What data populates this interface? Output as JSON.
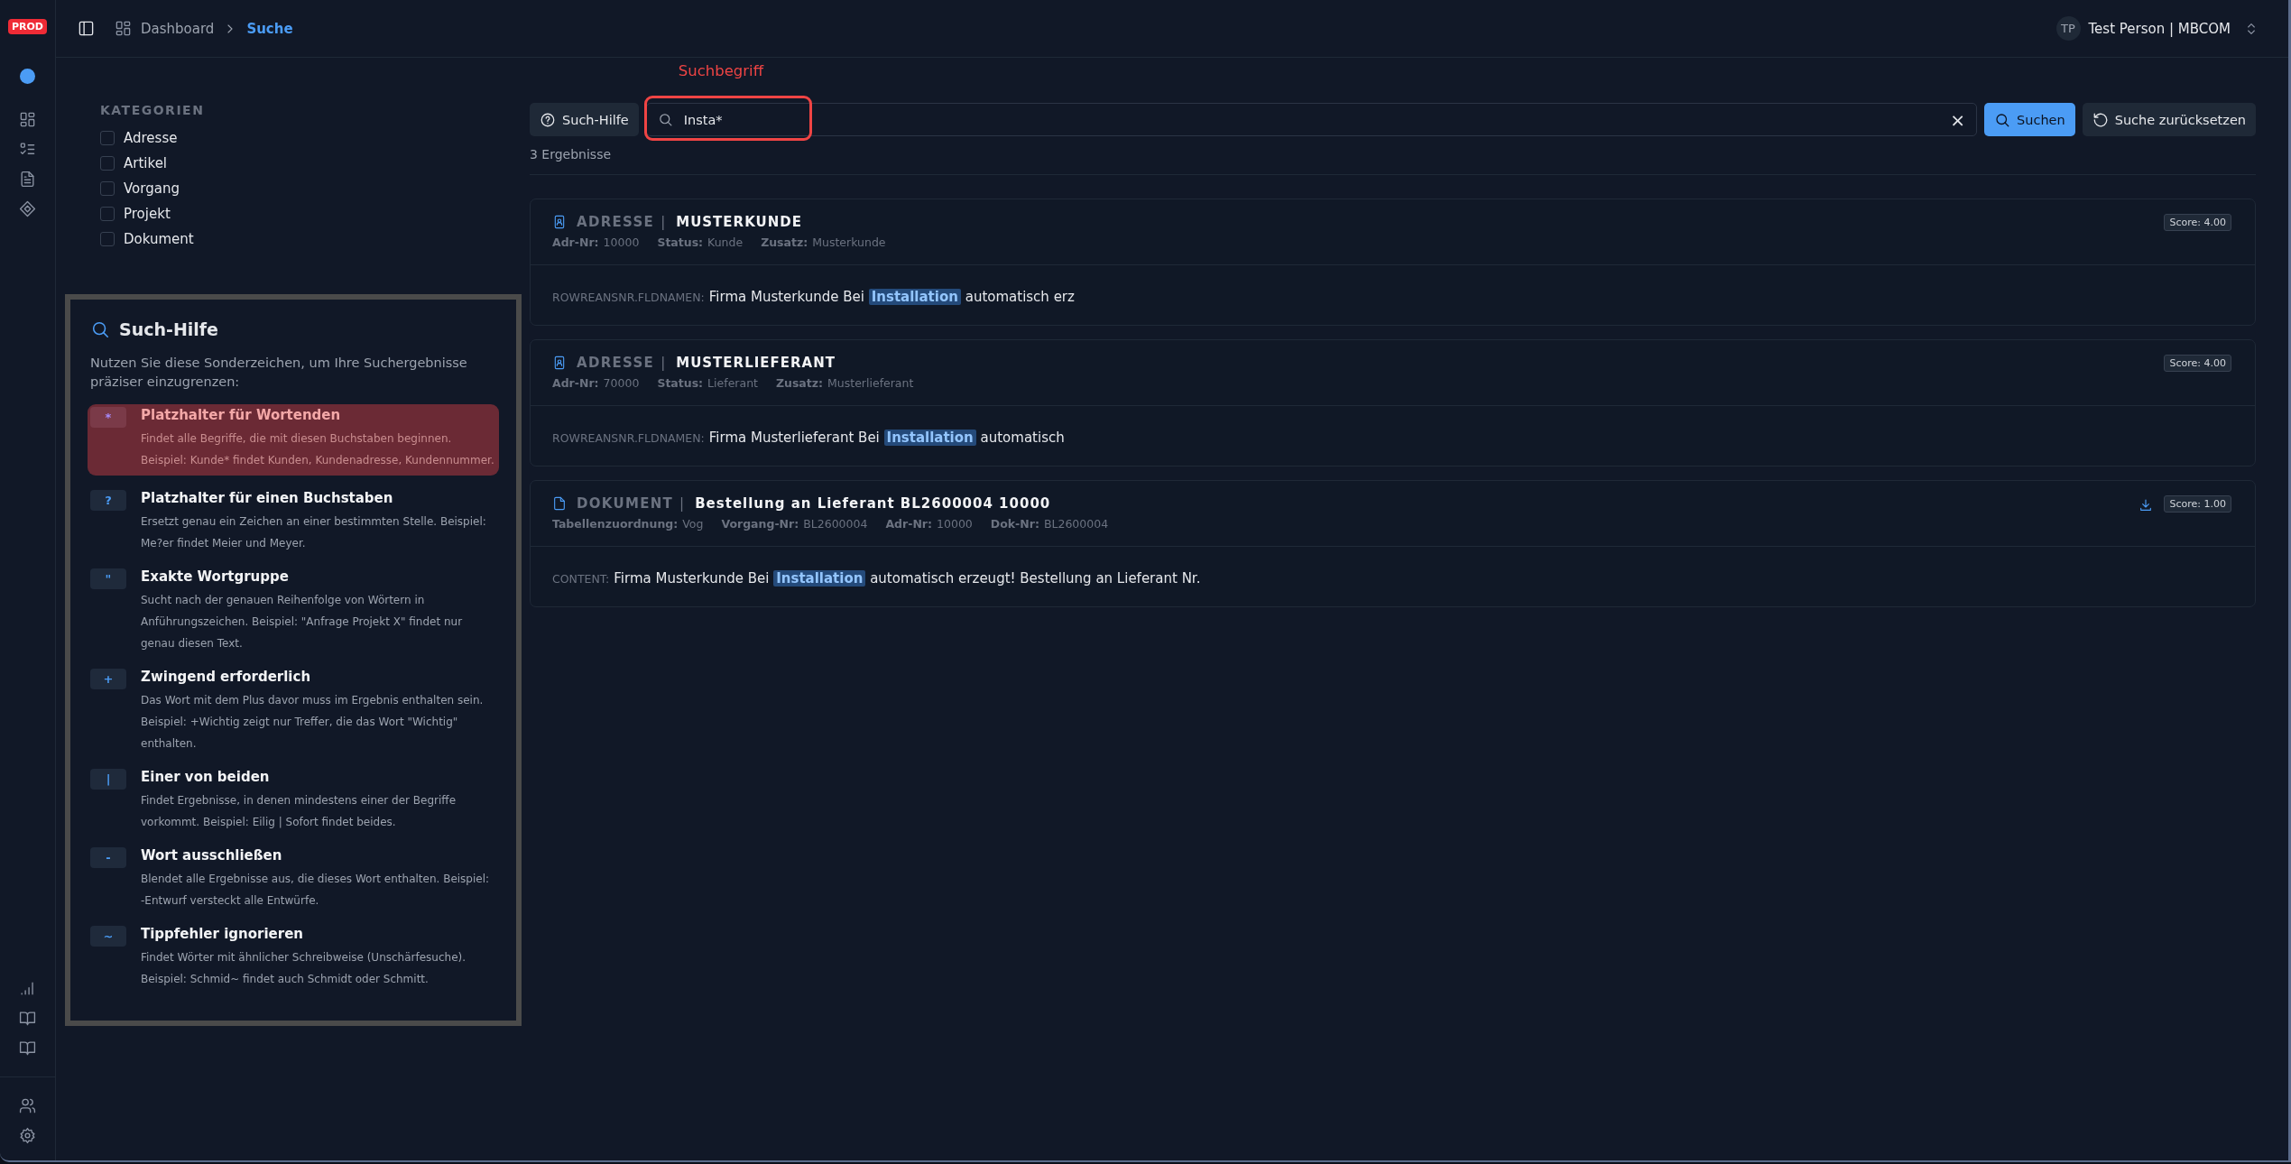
{
  "env_badge": "PROD",
  "breadcrumb": {
    "parent": "Dashboard",
    "current": "Suche"
  },
  "user": {
    "initials": "TP",
    "name": "Test Person | MBCOM"
  },
  "categories": {
    "title": "KATEGORIEN",
    "items": [
      {
        "label": "Adresse",
        "checked": false
      },
      {
        "label": "Artikel",
        "checked": false
      },
      {
        "label": "Vorgang",
        "checked": false
      },
      {
        "label": "Projekt",
        "checked": false
      },
      {
        "label": "Dokument",
        "checked": false
      }
    ]
  },
  "help": {
    "title": "Such-Hilfe",
    "intro": "Nutzen Sie diese Sonderzeichen, um Ihre Suchergebnisse präziser einzugrenzen:",
    "items": [
      {
        "symbol": "*",
        "title": "Platzhalter für Wortenden",
        "text": "Findet alle Begriffe, die mit diesen Buchstaben beginnen. Beispiel: Kunde* findet Kunden, Kundenadresse, Kundennummer.",
        "highlighted": true
      },
      {
        "symbol": "?",
        "title": "Platzhalter für einen Buchstaben",
        "text": "Ersetzt genau ein Zeichen an einer bestimmten Stelle. Beispiel: Me?er findet Meier und Meyer.",
        "highlighted": false
      },
      {
        "symbol": "\"",
        "title": "Exakte Wortgruppe",
        "text": "Sucht nach der genauen Reihenfolge von Wörtern in Anführungszeichen. Beispiel: \"Anfrage Projekt X\" findet nur genau diesen Text.",
        "highlighted": false
      },
      {
        "symbol": "+",
        "title": "Zwingend erforderlich",
        "text": "Das Wort mit dem Plus davor muss im Ergebnis enthalten sein. Beispiel: +Wichtig zeigt nur Treffer, die das Wort \"Wichtig\" enthalten.",
        "highlighted": false
      },
      {
        "symbol": "|",
        "title": "Einer von beiden",
        "text": "Findet Ergebnisse, in denen mindestens einer der Begriffe vorkommt. Beispiel: Eilig | Sofort findet beides.",
        "highlighted": false
      },
      {
        "symbol": "-",
        "title": "Wort ausschließen",
        "text": "Blendet alle Ergebnisse aus, die dieses Wort enthalten. Beispiel: -Entwurf versteckt alle Entwürfe.",
        "highlighted": false
      },
      {
        "symbol": "~",
        "title": "Tippfehler ignorieren",
        "text": "Findet Wörter mit ähnlicher Schreibweise (Unschärfesuche). Beispiel: Schmid~ findet auch Schmidt oder Schmitt.",
        "highlighted": false
      }
    ]
  },
  "search": {
    "help_button": "Such-Hilfe",
    "value": "Insta*",
    "annotation": "Suchbegriff",
    "clear": "×",
    "submit": "Suchen",
    "reset": "Suche zurücksetzen"
  },
  "result_count": "3 Ergebnisse",
  "results": [
    {
      "kind": "address",
      "type": "ADRESSE",
      "separator": "|",
      "title": "MUSTERKUNDE",
      "meta": [
        {
          "label": "Adr-Nr:",
          "value": "10000"
        },
        {
          "label": "Status:",
          "value": "Kunde"
        },
        {
          "label": "Zusatz:",
          "value": "Musterkunde"
        }
      ],
      "download": false,
      "score": "Score: 4.00",
      "field": "ROWREANSNR.FLDNAMEN:",
      "snippet": "Firma Musterkunde Bei **Installation** automatisch erz"
    },
    {
      "kind": "address",
      "type": "ADRESSE",
      "separator": "|",
      "title": "MUSTERLIEFERANT",
      "meta": [
        {
          "label": "Adr-Nr:",
          "value": "70000"
        },
        {
          "label": "Status:",
          "value": "Lieferant"
        },
        {
          "label": "Zusatz:",
          "value": "Musterlieferant"
        }
      ],
      "download": false,
      "score": "Score: 4.00",
      "field": "ROWREANSNR.FLDNAMEN:",
      "snippet": "Firma Musterlieferant Bei **Installation** automatisch"
    },
    {
      "kind": "document",
      "type": "DOKUMENT",
      "separator": "|",
      "title": "Bestellung an Lieferant BL2600004 10000",
      "meta": [
        {
          "label": "Tabellenzuordnung:",
          "value": "Vog"
        },
        {
          "label": "Vorgang-Nr:",
          "value": "BL2600004"
        },
        {
          "label": "Adr-Nr:",
          "value": "10000"
        },
        {
          "label": "Dok-Nr:",
          "value": "BL2600004"
        }
      ],
      "download": true,
      "score": "Score: 1.00",
      "field": "CONTENT:",
      "snippet": "Firma Musterkunde Bei **Installation** automatisch erzeugt! Bestellung an Lieferant Nr."
    }
  ]
}
